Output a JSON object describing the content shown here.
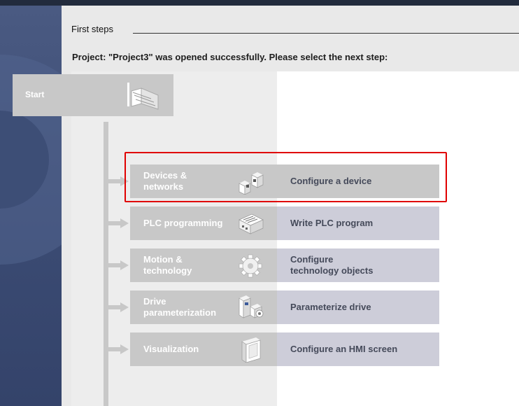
{
  "header": {
    "title": "First steps",
    "status": "Project: \"Project3\" was opened successfully. Please select the next step:"
  },
  "start": {
    "label": "Start"
  },
  "portals": [
    {
      "label_line1": "Devices &",
      "label_line2": "networks",
      "action_line1": "Configure a device",
      "action_line2": "",
      "icon": "devices-networks-icon"
    },
    {
      "label_line1": "PLC programming",
      "label_line2": "",
      "action_line1": "Write PLC program",
      "action_line2": "",
      "icon": "plc-programming-icon"
    },
    {
      "label_line1": "Motion &",
      "label_line2": "technology",
      "action_line1": "Configure",
      "action_line2": "technology objects",
      "icon": "motion-technology-icon"
    },
    {
      "label_line1": "Drive",
      "label_line2": "parameterization",
      "action_line1": "Parameterize drive",
      "action_line2": "",
      "icon": "drive-parameterization-icon"
    },
    {
      "label_line1": "Visualization",
      "label_line2": "",
      "action_line1": "Configure an HMI screen",
      "action_line2": "",
      "icon": "visualization-icon"
    }
  ],
  "colors": {
    "highlight": "#e00000",
    "portal_tile": "#c8c8c8",
    "action_tile": "#cdcdd9",
    "side_panel": "#3c4c74"
  }
}
